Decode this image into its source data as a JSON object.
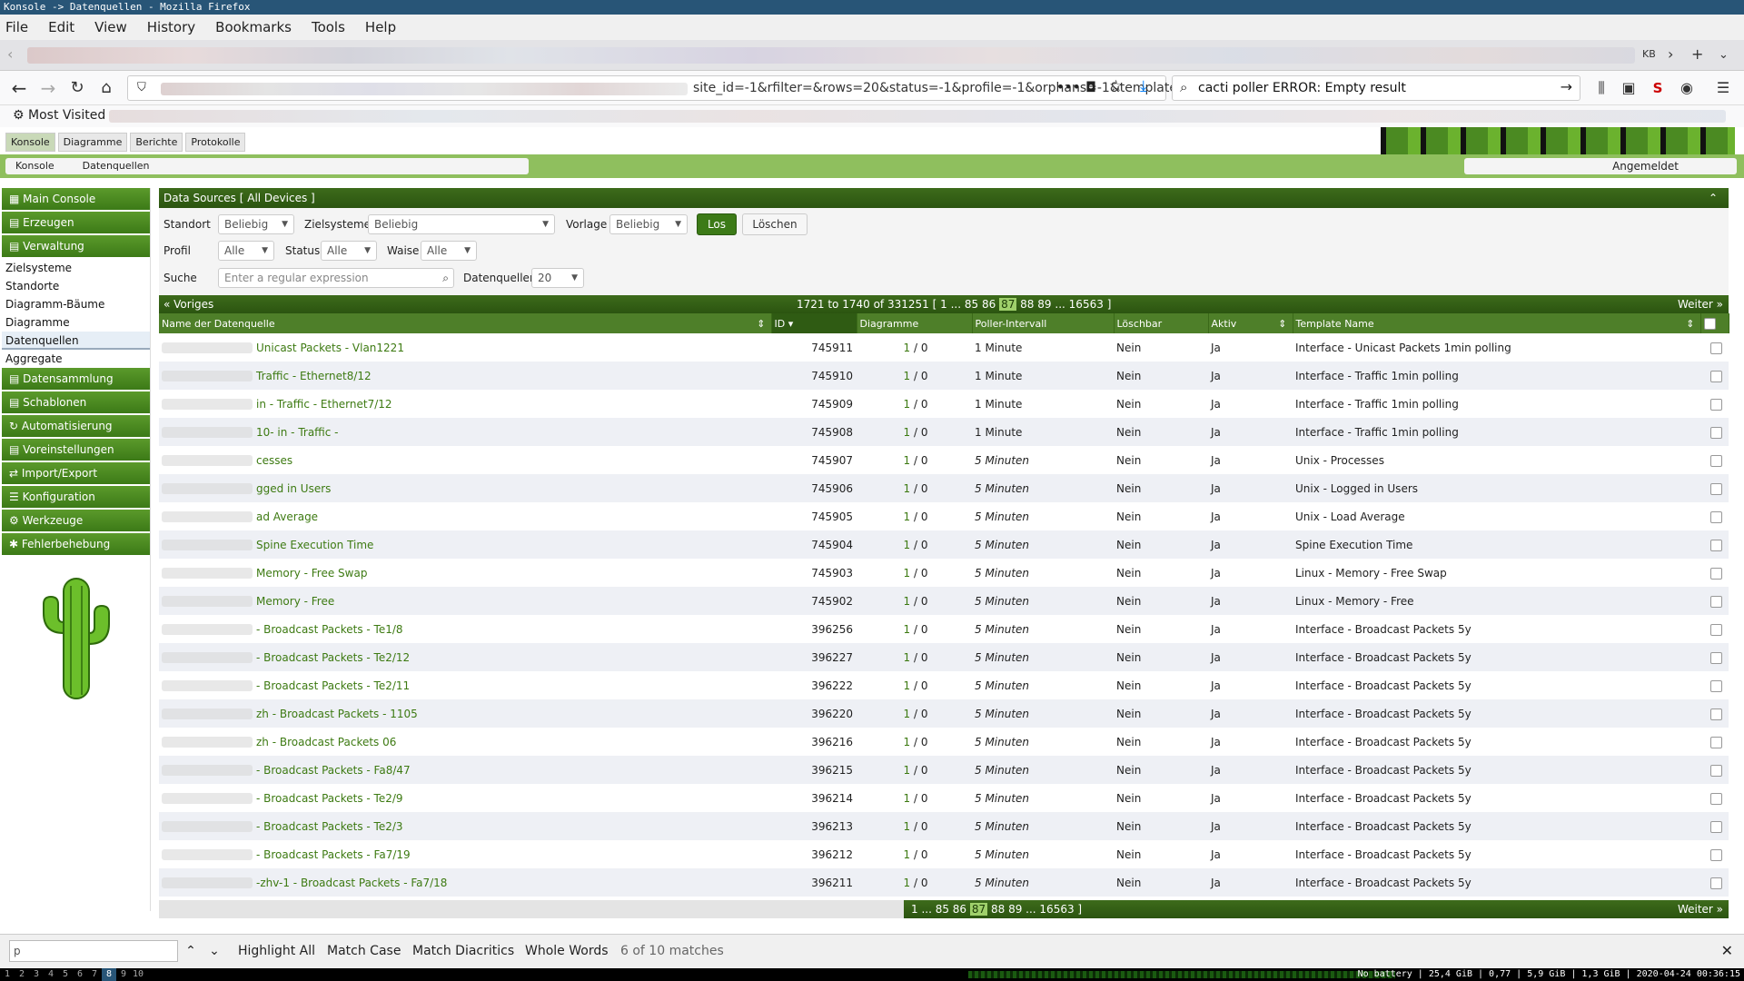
{
  "window_title": "Konsole -> Datenquellen - Mozilla Firefox",
  "menu": [
    "File",
    "Edit",
    "View",
    "History",
    "Bookmarks",
    "Tools",
    "Help"
  ],
  "tabstrip": {
    "kb_label": "KB"
  },
  "navbar": {
    "url_tail": "site_id=-1&rfilter=&rows=20&status=-1&profile=-1&orphans=-1&template_id",
    "search_value": "cacti poller ERROR: Empty result"
  },
  "bookmarks": {
    "most_visited": "Most Visited"
  },
  "cacti": {
    "tabs": [
      "Konsole",
      "Diagramme",
      "Berichte",
      "Protokolle"
    ],
    "breadcrumb": [
      "Konsole",
      "Datenquellen"
    ],
    "user_label": "Angemeldet"
  },
  "sidebar": {
    "main_console": "Main Console",
    "create": "Erzeugen",
    "management": "Verwaltung",
    "management_items": [
      "Zielsysteme",
      "Standorte",
      "Diagramm-Bäume",
      "Diagramme",
      "Datenquellen",
      "Aggregate"
    ],
    "headers": [
      "Datensammlung",
      "Schablonen",
      "Automatisierung",
      "Voreinstellungen",
      "Import/Export",
      "Konfiguration",
      "Werkzeuge",
      "Fehlerbehebung"
    ]
  },
  "panel": {
    "title": "Data Sources [ All Devices ]",
    "filters": {
      "site_label": "Standort",
      "site_value": "Beliebig",
      "devices_label": "Zielsysteme",
      "devices_value": "Beliebig",
      "template_label": "Vorlage",
      "template_value": "Beliebig",
      "go": "Los",
      "clear": "Löschen",
      "profile_label": "Profil",
      "profile_value": "Alle",
      "status_label": "Status",
      "status_value": "Alle",
      "orphan_label": "Waise",
      "orphan_value": "Alle",
      "search_label": "Suche",
      "search_placeholder": "Enter a regular expression",
      "ds_label": "Datenquellen",
      "ds_value": "20"
    },
    "pager": {
      "prev": "« Voriges",
      "info": "1721 to 1740 of 331251 [",
      "pages": [
        "1",
        "...",
        "85",
        "86",
        "87",
        "88",
        "89",
        "...",
        "16563"
      ],
      "current": "87",
      "close": "]",
      "next": "Weiter »"
    },
    "columns": [
      "Name der Datenquelle",
      "ID",
      "Diagramme",
      "Poller-Intervall",
      "Löschbar",
      "Aktiv",
      "Template Name"
    ],
    "rows": [
      {
        "name": "Unicast Packets - Vlan1221",
        "id": "745911",
        "graphs": "1 / 0",
        "interval": "1 Minute",
        "del": "Nein",
        "active": "Ja",
        "template": "Interface - Unicast Packets 1min polling"
      },
      {
        "name": "Traffic - Ethernet8/12",
        "id": "745910",
        "graphs": "1 / 0",
        "interval": "1 Minute",
        "del": "Nein",
        "active": "Ja",
        "template": "Interface - Traffic 1min polling"
      },
      {
        "name": "in - Traffic - Ethernet7/12",
        "id": "745909",
        "graphs": "1 / 0",
        "interval": "1 Minute",
        "del": "Nein",
        "active": "Ja",
        "template": "Interface - Traffic 1min polling"
      },
      {
        "name": "10-    in - Traffic -",
        "id": "745908",
        "graphs": "1 / 0",
        "interval": "1 Minute",
        "del": "Nein",
        "active": "Ja",
        "template": "Interface - Traffic 1min polling"
      },
      {
        "name": "cesses",
        "id": "745907",
        "graphs": "1 / 0",
        "interval": "5 Minuten",
        "del": "Nein",
        "active": "Ja",
        "template": "Unix - Processes"
      },
      {
        "name": "gged in Users",
        "id": "745906",
        "graphs": "1 / 0",
        "interval": "5 Minuten",
        "del": "Nein",
        "active": "Ja",
        "template": "Unix - Logged in Users"
      },
      {
        "name": "ad Average",
        "id": "745905",
        "graphs": "1 / 0",
        "interval": "5 Minuten",
        "del": "Nein",
        "active": "Ja",
        "template": "Unix - Load Average"
      },
      {
        "name": "Spine Execution Time",
        "id": "745904",
        "graphs": "1 / 0",
        "interval": "5 Minuten",
        "del": "Nein",
        "active": "Ja",
        "template": "Spine Execution Time"
      },
      {
        "name": "Memory - Free Swap",
        "id": "745903",
        "graphs": "1 / 0",
        "interval": "5 Minuten",
        "del": "Nein",
        "active": "Ja",
        "template": "Linux - Memory - Free Swap"
      },
      {
        "name": "Memory - Free",
        "id": "745902",
        "graphs": "1 / 0",
        "interval": "5 Minuten",
        "del": "Nein",
        "active": "Ja",
        "template": "Linux - Memory - Free"
      },
      {
        "name": "- Broadcast Packets - Te1/8",
        "id": "396256",
        "graphs": "1 / 0",
        "interval": "5 Minuten",
        "del": "Nein",
        "active": "Ja",
        "template": "Interface - Broadcast Packets 5y"
      },
      {
        "name": "- Broadcast Packets - Te2/12",
        "id": "396227",
        "graphs": "1 / 0",
        "interval": "5 Minuten",
        "del": "Nein",
        "active": "Ja",
        "template": "Interface - Broadcast Packets 5y"
      },
      {
        "name": "- Broadcast Packets - Te2/11",
        "id": "396222",
        "graphs": "1 / 0",
        "interval": "5 Minuten",
        "del": "Nein",
        "active": "Ja",
        "template": "Interface - Broadcast Packets 5y"
      },
      {
        "name": "zh - Broadcast Packets -                    1105",
        "id": "396220",
        "graphs": "1 / 0",
        "interval": "5 Minuten",
        "del": "Nein",
        "active": "Ja",
        "template": "Interface - Broadcast Packets 5y"
      },
      {
        "name": "zh - Broadcast Packets                    06",
        "id": "396216",
        "graphs": "1 / 0",
        "interval": "5 Minuten",
        "del": "Nein",
        "active": "Ja",
        "template": "Interface - Broadcast Packets 5y"
      },
      {
        "name": "- Broadcast Packets - Fa8/47",
        "id": "396215",
        "graphs": "1 / 0",
        "interval": "5 Minuten",
        "del": "Nein",
        "active": "Ja",
        "template": "Interface - Broadcast Packets 5y"
      },
      {
        "name": "- Broadcast Packets - Te2/9",
        "id": "396214",
        "graphs": "1 / 0",
        "interval": "5 Minuten",
        "del": "Nein",
        "active": "Ja",
        "template": "Interface - Broadcast Packets 5y"
      },
      {
        "name": "- Broadcast Packets - Te2/3",
        "id": "396213",
        "graphs": "1 / 0",
        "interval": "5 Minuten",
        "del": "Nein",
        "active": "Ja",
        "template": "Interface - Broadcast Packets 5y"
      },
      {
        "name": "- Broadcast Packets - Fa7/19",
        "id": "396212",
        "graphs": "1 / 0",
        "interval": "5 Minuten",
        "del": "Nein",
        "active": "Ja",
        "template": "Interface - Broadcast Packets 5y"
      },
      {
        "name": "-zhv-1 - Broadcast Packets - Fa7/18",
        "id": "396211",
        "graphs": "1 / 0",
        "interval": "5 Minuten",
        "del": "Nein",
        "active": "Ja",
        "template": "Interface - Broadcast Packets 5y"
      }
    ],
    "bottom_pager": {
      "pages": "1 ... 85  86",
      "current": "87",
      "pages_after": "88  89 ... 16563  ]",
      "next": "Weiter »"
    }
  },
  "findbar": {
    "input_value": "p",
    "highlight_all": "Highlight All",
    "match_case": "Match Case",
    "match_diacritics": "Match Diacritics",
    "whole_words": "Whole Words",
    "status": "6 of 10 matches"
  },
  "statusbar": {
    "workspaces": [
      "1",
      "2",
      "3",
      "4",
      "5",
      "6",
      "7",
      "8",
      "9",
      "10"
    ],
    "active_workspace": "8",
    "right": "No battery | 25,4 GiB | 0,77 | 5,9 GiB | 1,3 GiB | 2020-04-24 00:36:15"
  },
  "colors": {
    "cacti_green": "#3c7a17",
    "header_green": "#4e7f29",
    "link_green": "#3d7a12"
  }
}
